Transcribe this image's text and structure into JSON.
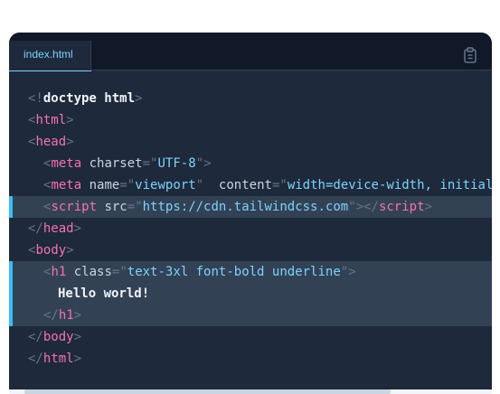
{
  "editor": {
    "tab_label": "index.html",
    "copy_icon": "clipboard-icon"
  },
  "colors": {
    "background": "#1e293b",
    "tabbar": "#111827",
    "highlight": "#334155",
    "accent": "#38bdf8",
    "tag": "#f472b6",
    "string": "#7dd3fc",
    "punctuation": "#64748b"
  },
  "code": {
    "l1": {
      "open": "<!",
      "keyword": "doctype html",
      "close": ">"
    },
    "l2": {
      "open": "<",
      "tag": "html",
      "close": ">"
    },
    "l3": {
      "open": "<",
      "tag": "head",
      "close": ">"
    },
    "l4": {
      "open": "<",
      "tag": "meta",
      "attr": "charset",
      "eq": "=",
      "q1": "\"",
      "val": "UTF-8",
      "q2": "\"",
      "close": ">"
    },
    "l5": {
      "open": "<",
      "tag": "meta",
      "attr1": "name",
      "eq1": "=",
      "q1": "\"",
      "val1": "viewport",
      "q2": "\"",
      "attr2": "content",
      "eq2": "=",
      "q3": "\"",
      "val2": "width=device-width, initial"
    },
    "l6": {
      "open": "<",
      "tag": "script",
      "attr": "src",
      "eq": "=",
      "q1": "\"",
      "val": "https://cdn.tailwindcss.com",
      "q2": "\"",
      "close1": "></",
      "tag2": "script",
      "close2": ">"
    },
    "l7": {
      "open": "</",
      "tag": "head",
      "close": ">"
    },
    "l8": {
      "open": "<",
      "tag": "body",
      "close": ">"
    },
    "l9": {
      "open": "<",
      "tag": "h1",
      "attr": "class",
      "eq": "=",
      "q1": "\"",
      "val": "text-3xl font-bold underline",
      "q2": "\"",
      "close": ">"
    },
    "l10": {
      "text": "Hello world!"
    },
    "l11": {
      "open": "</",
      "tag": "h1",
      "close": ">"
    },
    "l12": {
      "open": "</",
      "tag": "body",
      "close": ">"
    },
    "l13": {
      "open": "</",
      "tag": "html",
      "close": ">"
    }
  }
}
